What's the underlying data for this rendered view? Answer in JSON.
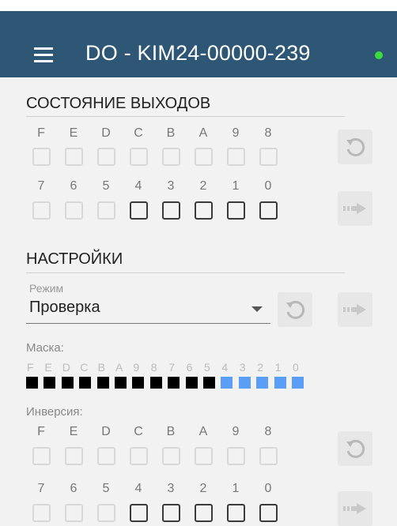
{
  "appbar": {
    "title": "DO - KIM24-00000-239",
    "menu_icon": "hamburger-menu-icon",
    "status_color": "#3ddc3d",
    "background": "#2e5675"
  },
  "outputs": {
    "title": "СОСТОЯНИЕ ВЫХОДОВ",
    "high_labels": [
      "F",
      "E",
      "D",
      "C",
      "B",
      "A",
      "9",
      "8"
    ],
    "low_labels": [
      "7",
      "6",
      "5",
      "4",
      "3",
      "2",
      "1",
      "0"
    ],
    "high_enabled": [
      false,
      false,
      false,
      false,
      false,
      false,
      false,
      false
    ],
    "low_enabled": [
      false,
      false,
      false,
      true,
      true,
      true,
      true,
      true
    ],
    "reset_icon": "undo-icon",
    "apply_icon": "arrow-right-icon"
  },
  "settings": {
    "title": "НАСТРОЙКИ",
    "mode_label": "Режим",
    "mode_value": "Проверка",
    "reset_icon": "undo-icon",
    "apply_icon": "arrow-right-icon"
  },
  "mask": {
    "label": "Маска:",
    "bit_labels": [
      "F",
      "E",
      "D",
      "C",
      "B",
      "A",
      "9",
      "8",
      "7",
      "6",
      "5",
      "4",
      "3",
      "2",
      "1",
      "0"
    ],
    "states": [
      1,
      1,
      1,
      1,
      1,
      1,
      1,
      1,
      1,
      1,
      1,
      0,
      0,
      0,
      0,
      0
    ],
    "color_on": "#000000",
    "color_off": "#5a9ef5"
  },
  "inversion": {
    "label": "Инверсия:",
    "high_labels": [
      "F",
      "E",
      "D",
      "C",
      "B",
      "A",
      "9",
      "8"
    ],
    "low_labels": [
      "7",
      "6",
      "5",
      "4",
      "3",
      "2",
      "1",
      "0"
    ],
    "high_enabled": [
      false,
      false,
      false,
      false,
      false,
      false,
      false,
      false
    ],
    "low_enabled": [
      false,
      false,
      false,
      true,
      true,
      true,
      true,
      true
    ],
    "reset_icon": "undo-icon",
    "apply_icon": "arrow-right-icon"
  }
}
